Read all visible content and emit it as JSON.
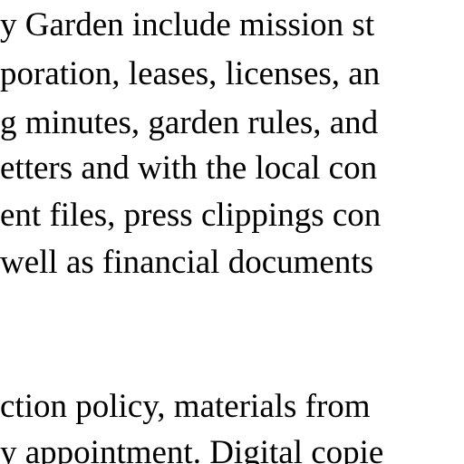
{
  "document": {
    "paragraph_1": [
      "y Garden include mission st",
      "poration, leases, licenses, an",
      "g minutes, garden rules, and",
      "etters and with the local con",
      "ent files, press clippings con",
      "well as financial documents"
    ],
    "paragraph_2": [
      "ction policy, materials from",
      "y appointment. Digital copie"
    ]
  }
}
